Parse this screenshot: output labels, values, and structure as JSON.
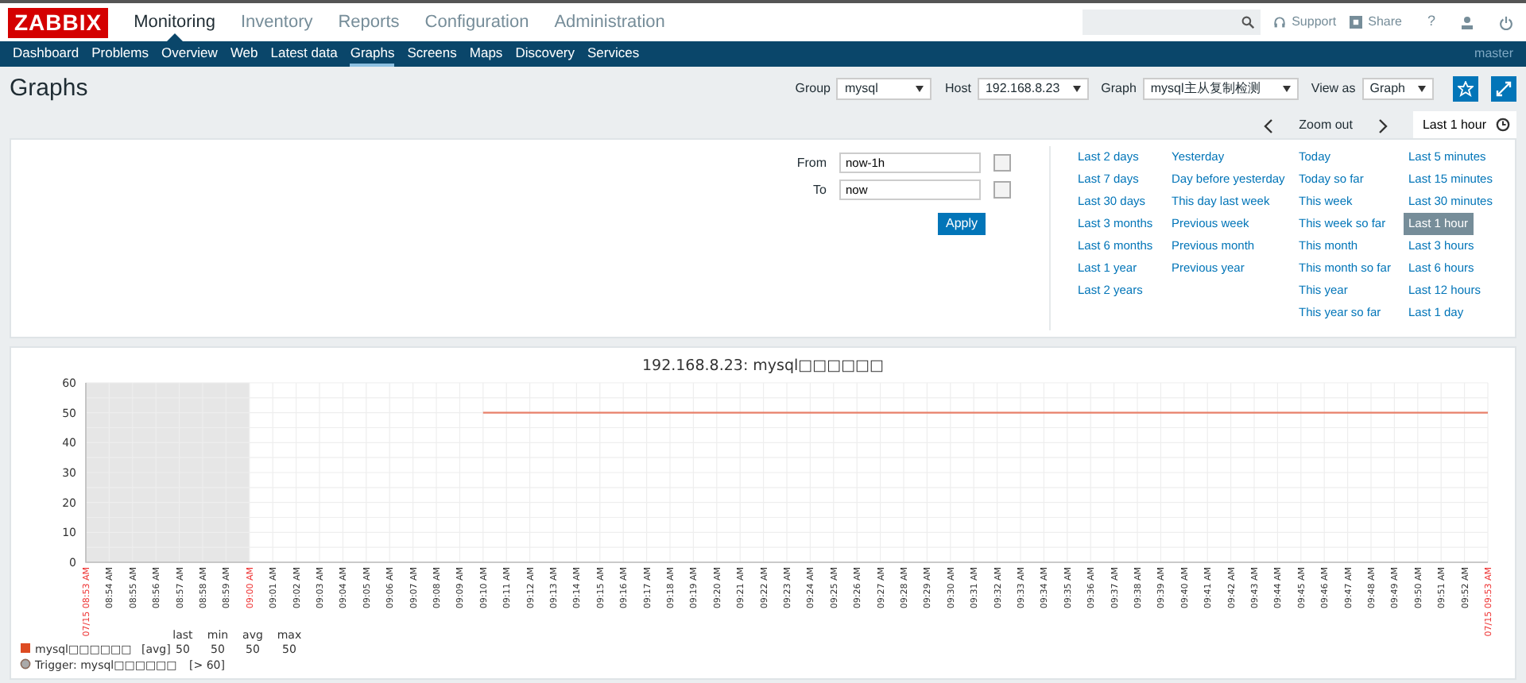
{
  "header": {
    "logo": "ZABBIX",
    "menu": [
      {
        "label": "Monitoring",
        "selected": true
      },
      {
        "label": "Inventory",
        "selected": false
      },
      {
        "label": "Reports",
        "selected": false
      },
      {
        "label": "Configuration",
        "selected": false
      },
      {
        "label": "Administration",
        "selected": false
      }
    ],
    "links": [
      "Support",
      "Share"
    ],
    "help": "?"
  },
  "subnav": {
    "items": [
      {
        "label": "Dashboard",
        "selected": false
      },
      {
        "label": "Problems",
        "selected": false
      },
      {
        "label": "Overview",
        "selected": false
      },
      {
        "label": "Web",
        "selected": false
      },
      {
        "label": "Latest data",
        "selected": false
      },
      {
        "label": "Graphs",
        "selected": true
      },
      {
        "label": "Screens",
        "selected": false
      },
      {
        "label": "Maps",
        "selected": false
      },
      {
        "label": "Discovery",
        "selected": false
      },
      {
        "label": "Services",
        "selected": false
      }
    ],
    "user": "master"
  },
  "page": {
    "title": "Graphs",
    "filters": [
      {
        "label": "Group",
        "value": "mysql"
      },
      {
        "label": "Host",
        "value": "192.168.8.23"
      },
      {
        "label": "Graph",
        "value": "mysql主从复制检测"
      },
      {
        "label": "View as",
        "value": "Graph"
      }
    ]
  },
  "timebar": {
    "zoom": "Zoom out",
    "tab": "Last 1 hour"
  },
  "time_filter": {
    "from": {
      "label": "From",
      "value": "now-1h"
    },
    "to": {
      "label": "To",
      "value": "now"
    },
    "apply": "Apply",
    "ranges": [
      [
        {
          "label": "Last 2 days",
          "selected": false
        },
        {
          "label": "Last 7 days",
          "selected": false
        },
        {
          "label": "Last 30 days",
          "selected": false
        },
        {
          "label": "Last 3 months",
          "selected": false
        },
        {
          "label": "Last 6 months",
          "selected": false
        },
        {
          "label": "Last 1 year",
          "selected": false
        },
        {
          "label": "Last 2 years",
          "selected": false
        }
      ],
      [
        {
          "label": "Yesterday",
          "selected": false
        },
        {
          "label": "Day before yesterday",
          "selected": false
        },
        {
          "label": "This day last week",
          "selected": false
        },
        {
          "label": "Previous week",
          "selected": false
        },
        {
          "label": "Previous month",
          "selected": false
        },
        {
          "label": "Previous year",
          "selected": false
        }
      ],
      [
        {
          "label": "Today",
          "selected": false
        },
        {
          "label": "Today so far",
          "selected": false
        },
        {
          "label": "This week",
          "selected": false
        },
        {
          "label": "This week so far",
          "selected": false
        },
        {
          "label": "This month",
          "selected": false
        },
        {
          "label": "This month so far",
          "selected": false
        },
        {
          "label": "This year",
          "selected": false
        },
        {
          "label": "This year so far",
          "selected": false
        }
      ],
      [
        {
          "label": "Last 5 minutes",
          "selected": false
        },
        {
          "label": "Last 15 minutes",
          "selected": false
        },
        {
          "label": "Last 30 minutes",
          "selected": false
        },
        {
          "label": "Last 1 hour",
          "selected": true
        },
        {
          "label": "Last 3 hours",
          "selected": false
        },
        {
          "label": "Last 6 hours",
          "selected": false
        },
        {
          "label": "Last 12 hours",
          "selected": false
        },
        {
          "label": "Last 1 day",
          "selected": false
        }
      ]
    ]
  },
  "graph": {
    "title": "192.168.8.23: mysql□□□□□□",
    "chart_data": {
      "type": "line",
      "categories": [
        "07/15 08:53 AM",
        "08:54 AM",
        "08:55 AM",
        "08:56 AM",
        "08:57 AM",
        "08:58 AM",
        "08:59 AM",
        "09:00 AM",
        "09:01 AM",
        "09:02 AM",
        "09:03 AM",
        "09:04 AM",
        "09:05 AM",
        "09:06 AM",
        "09:07 AM",
        "09:08 AM",
        "09:09 AM",
        "09:10 AM",
        "09:11 AM",
        "09:12 AM",
        "09:13 AM",
        "09:14 AM",
        "09:15 AM",
        "09:16 AM",
        "09:17 AM",
        "09:18 AM",
        "09:19 AM",
        "09:20 AM",
        "09:21 AM",
        "09:22 AM",
        "09:23 AM",
        "09:24 AM",
        "09:25 AM",
        "09:26 AM",
        "09:27 AM",
        "09:28 AM",
        "09:29 AM",
        "09:30 AM",
        "09:31 AM",
        "09:32 AM",
        "09:33 AM",
        "09:34 AM",
        "09:35 AM",
        "09:36 AM",
        "09:37 AM",
        "09:38 AM",
        "09:39 AM",
        "09:40 AM",
        "09:41 AM",
        "09:42 AM",
        "09:43 AM",
        "09:44 AM",
        "09:45 AM",
        "09:46 AM",
        "09:47 AM",
        "09:48 AM",
        "09:49 AM",
        "09:50 AM",
        "09:51 AM",
        "09:52 AM",
        "07/15 09:53 AM"
      ],
      "series": [
        {
          "name": "mysql□□□□□□",
          "color": "#e8806a",
          "values": [
            null,
            null,
            null,
            null,
            null,
            null,
            null,
            null,
            null,
            null,
            null,
            null,
            null,
            null,
            null,
            null,
            null,
            50,
            50,
            50,
            50,
            50,
            50,
            50,
            50,
            50,
            50,
            50,
            50,
            50,
            50,
            50,
            50,
            50,
            50,
            50,
            50,
            50,
            50,
            50,
            50,
            50,
            50,
            50,
            50,
            50,
            50,
            50,
            50,
            50,
            50,
            50,
            50,
            50,
            50,
            50,
            50,
            50,
            50,
            50,
            50
          ]
        }
      ],
      "ylim": [
        0,
        60
      ],
      "yticks": [
        0,
        10,
        20,
        30,
        40,
        50,
        60
      ],
      "grid": true
    },
    "legend": {
      "header": [
        "last",
        "min",
        "avg",
        "max"
      ],
      "items": [
        {
          "kind": "item",
          "color": "#dd4b22",
          "func": "[avg]",
          "values": [
            "50",
            "50",
            "50",
            "50"
          ]
        },
        {
          "kind": "trigger",
          "name": "Trigger: mysql□□□□□□",
          "condition": "[> 60]"
        }
      ]
    }
  }
}
